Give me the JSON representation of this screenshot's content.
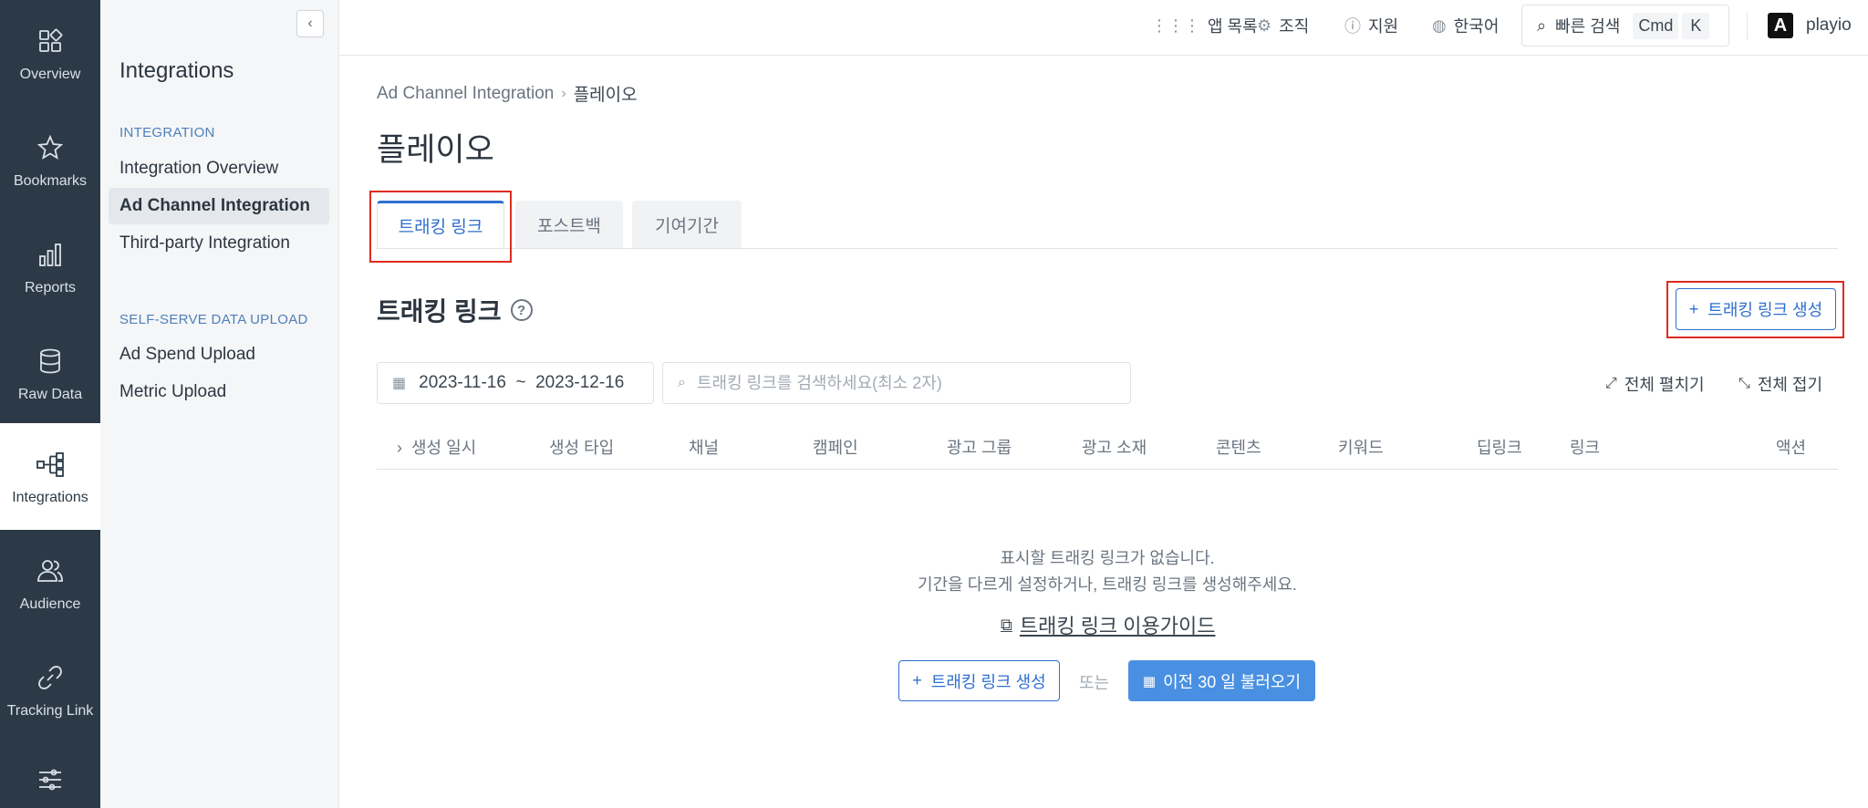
{
  "rail": {
    "items": [
      {
        "label": "Overview",
        "icon": "overview-icon"
      },
      {
        "label": "Bookmarks",
        "icon": "star-icon"
      },
      {
        "label": "Reports",
        "icon": "bar-chart-icon"
      },
      {
        "label": "Raw Data",
        "icon": "database-icon"
      },
      {
        "label": "Integrations",
        "icon": "integrations-icon",
        "active": true
      },
      {
        "label": "Audience",
        "icon": "users-icon"
      },
      {
        "label": "Tracking Link",
        "icon": "link-icon"
      }
    ]
  },
  "sidebar": {
    "title": "Integrations",
    "section1": "INTEGRATION",
    "links1": [
      "Integration Overview",
      "Ad Channel Integration",
      "Third-party Integration"
    ],
    "section2": "SELF-SERVE DATA UPLOAD",
    "links2": [
      "Ad Spend Upload",
      "Metric Upload"
    ]
  },
  "topbar": {
    "app_list": "앱 목록",
    "org": "조직",
    "support": "지원",
    "language": "한국어",
    "quick_search": "빠른 검색",
    "kbd1": "Cmd",
    "kbd2": "K",
    "brand": "playio",
    "brand_logo": "A"
  },
  "breadcrumb": {
    "parent": "Ad Channel Integration",
    "current": "플레이오"
  },
  "page_title": "플레이오",
  "tabs": [
    "트래킹 링크",
    "포스트백",
    "기여기간"
  ],
  "section": {
    "title": "트래킹 링크",
    "create_button": "트래킹 링크 생성",
    "date_range": "2023-11-16  ~  2023-12-16",
    "search_placeholder": "트래킹 링크를 검색하세요(최소 2자)",
    "expand_all": "전체 펼치기",
    "collapse_all": "전체 접기"
  },
  "table": {
    "columns": [
      "생성 일시",
      "생성 타입",
      "채널",
      "캠페인",
      "광고 그룹",
      "광고 소재",
      "콘텐츠",
      "키워드",
      "딥링크",
      "링크",
      "액션"
    ]
  },
  "empty": {
    "line1": "표시할 트래킹 링크가 없습니다.",
    "line2": "기간을 다르게 설정하거나, 트래킹 링크를 생성해주세요.",
    "guide": "트래킹 링크 이용가이드",
    "create_button": "트래킹 링크 생성",
    "or": "또는",
    "load_button": "이전 30 일 불러오기"
  },
  "colors": {
    "rail": "#2c3a47",
    "accent": "#2f6fcf",
    "primary_button": "#4a90e2",
    "highlight": "#e02b20"
  }
}
